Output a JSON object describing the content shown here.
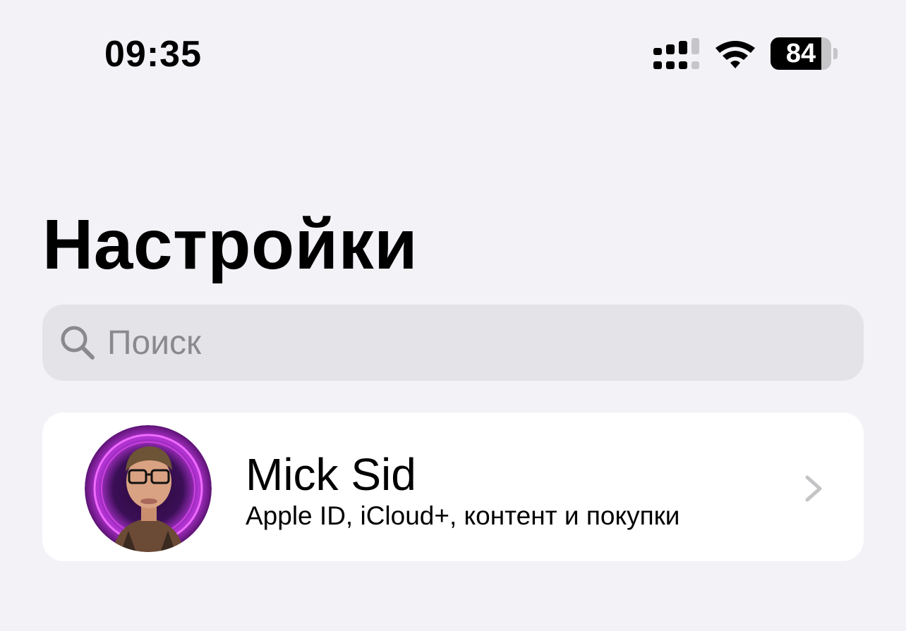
{
  "status_bar": {
    "time": "09:35",
    "battery_level": "84",
    "battery_fraction": 0.84,
    "icons": [
      "cellular-signal-icon",
      "wifi-icon",
      "battery-icon"
    ]
  },
  "page": {
    "title": "Настройки"
  },
  "search": {
    "placeholder": "Поиск",
    "value": "",
    "icon": "search-icon"
  },
  "profile": {
    "name": "Mick Sid",
    "subtitle": "Apple ID, iCloud+, контент и покупки",
    "icon": "chevron-right-icon"
  },
  "colors": {
    "background": "#f2f2f7",
    "search_field": "#e3e3e8",
    "placeholder": "#8a8a8e",
    "card": "#ffffff",
    "chevron": "#c4c4c7",
    "avatar_glow": "#c637e0"
  }
}
